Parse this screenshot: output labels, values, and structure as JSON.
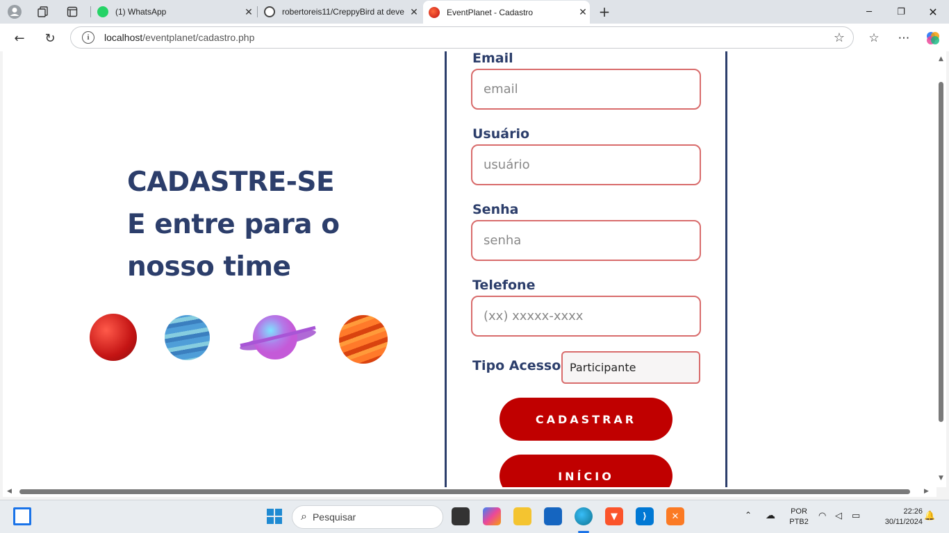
{
  "browser": {
    "tabs": [
      {
        "title": "(1) WhatsApp",
        "active": false
      },
      {
        "title": "robertoreis11/CreppyBird at deve",
        "active": false
      },
      {
        "title": "EventPlanet - Cadastro",
        "active": true
      }
    ],
    "url_host": "localhost",
    "url_path": "/eventplanet/cadastro.php"
  },
  "hero": {
    "line1": "CADASTRE-SE",
    "line2": "E entre para o",
    "line3": "nosso time"
  },
  "form": {
    "email_label": "Email",
    "email_placeholder": "email",
    "user_label": "Usuário",
    "user_placeholder": "usuário",
    "password_label": "Senha",
    "password_placeholder": "senha",
    "phone_label": "Telefone",
    "phone_placeholder": "(xx) xxxxx-xxxx",
    "access_label": "Tipo Acesso:",
    "access_value": "Participante",
    "submit_label": "CADASTRAR",
    "home_label": "INÍCIO"
  },
  "colors": {
    "brand": "#2c3e6b",
    "button": "#c00000",
    "input_border": "#d86b6b"
  },
  "taskbar": {
    "search_placeholder": "Pesquisar",
    "lang_top": "POR",
    "lang_bottom": "PTB2",
    "time": "22:26",
    "date": "30/11/2024"
  }
}
